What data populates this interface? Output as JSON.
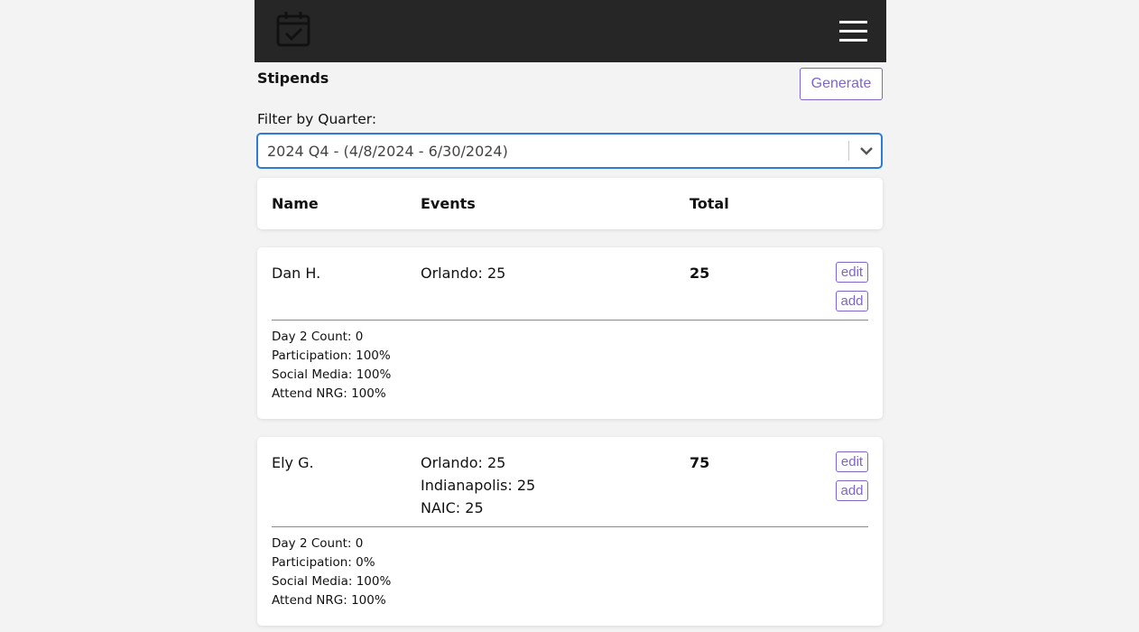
{
  "header": {
    "logo_icon": "calendar-check-icon",
    "menu_icon": "hamburger-menu-icon",
    "background": "#262626"
  },
  "page": {
    "title": "Stipends",
    "generate_label": "Generate",
    "accent_color": "#8065c8"
  },
  "filter": {
    "label": "Filter by Quarter:",
    "selected": "2024 Q4 - (4/8/2024 - 6/30/2024)",
    "focus_color": "#2e7bd6"
  },
  "table": {
    "columns": [
      "Name",
      "Events",
      "Total"
    ],
    "rows": [
      {
        "name": "Dan H.",
        "events": [
          "Orlando: 25"
        ],
        "total": "25",
        "edit_label": "edit",
        "add_label": "add",
        "details": [
          "Day 2 Count: 0",
          "Participation: 100%",
          "Social Media: 100%",
          "Attend NRG: 100%"
        ]
      },
      {
        "name": "Ely G.",
        "events": [
          "Orlando: 25",
          "Indianapolis: 25",
          "NAIC: 25"
        ],
        "total": "75",
        "edit_label": "edit",
        "add_label": "add",
        "details": [
          "Day 2 Count: 0",
          "Participation: 0%",
          "Social Media: 100%",
          "Attend NRG: 100%"
        ]
      }
    ]
  }
}
